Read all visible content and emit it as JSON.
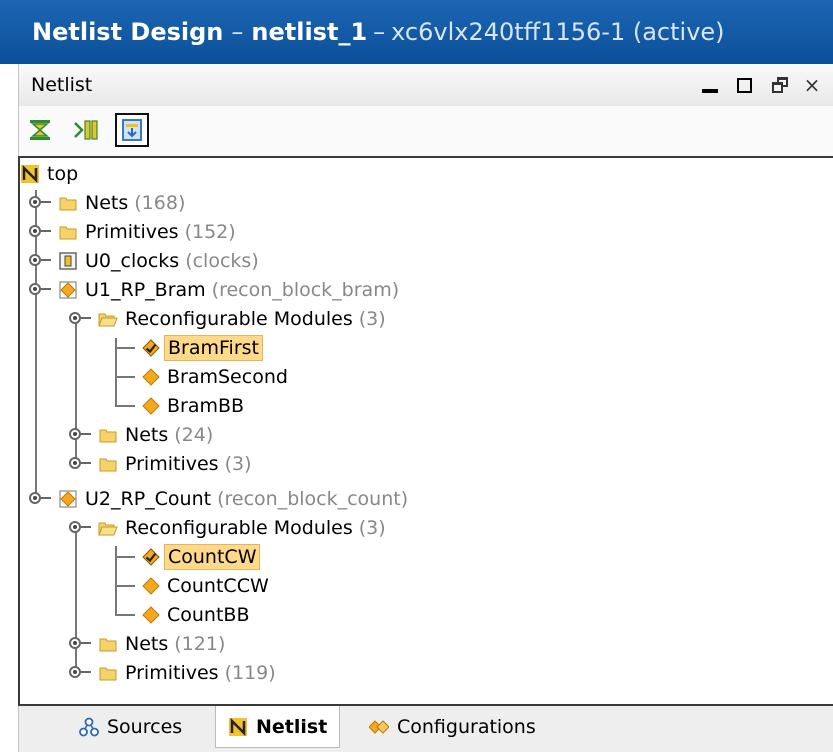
{
  "window": {
    "title_prefix": "Netlist Design",
    "title_sep1": "–",
    "title_bold": "netlist_1",
    "title_sep2": "–",
    "title_rest": "xc6vlx240tff1156-1 (active)"
  },
  "panel": {
    "title": "Netlist",
    "close_glyph": "×"
  },
  "toolbar": {
    "buttons": [
      {
        "icon": "collapse-all-icon"
      },
      {
        "icon": "expand-all-icon"
      },
      {
        "icon": "show-hierarchy-icon",
        "active": true
      }
    ]
  },
  "tree": {
    "root": "top",
    "nodes": [
      {
        "label": "Nets",
        "paren": "(168)",
        "icon": "folder-icon"
      },
      {
        "label": "Primitives",
        "paren": "(152)",
        "icon": "folder-icon"
      },
      {
        "label": "U0_clocks",
        "paren": "(clocks)",
        "icon": "black-box-cell-icon"
      },
      {
        "label": "U1_RP_Bram",
        "paren": "(recon_block_bram)",
        "icon": "reconfigurable-partition-icon"
      },
      {
        "label": "Reconfigurable Modules",
        "paren": "(3)",
        "icon": "open-folder-icon"
      },
      {
        "label": "BramFirst",
        "paren": "",
        "icon": "active-module-icon",
        "selected": true
      },
      {
        "label": "BramSecond",
        "paren": "",
        "icon": "module-icon"
      },
      {
        "label": "BramBB",
        "paren": "",
        "icon": "module-icon"
      },
      {
        "label": "Nets",
        "paren": "(24)",
        "icon": "folder-icon"
      },
      {
        "label": "Primitives",
        "paren": "(3)",
        "icon": "folder-icon"
      },
      {
        "label": "U2_RP_Count",
        "paren": "(recon_block_count)",
        "icon": "reconfigurable-partition-icon"
      },
      {
        "label": "Reconfigurable Modules",
        "paren": "(3)",
        "icon": "open-folder-icon"
      },
      {
        "label": "CountCW",
        "paren": "",
        "icon": "active-module-icon",
        "selected": true
      },
      {
        "label": "CountCCW",
        "paren": "",
        "icon": "module-icon"
      },
      {
        "label": "CountBB",
        "paren": "",
        "icon": "module-icon"
      },
      {
        "label": "Nets",
        "paren": "(121)",
        "icon": "folder-icon"
      },
      {
        "label": "Primitives",
        "paren": "(119)",
        "icon": "folder-icon"
      }
    ]
  },
  "tabs": [
    {
      "label": "Sources",
      "icon": "sources-icon"
    },
    {
      "label": "Netlist",
      "icon": "netlist-icon",
      "active": true
    },
    {
      "label": "Configurations",
      "icon": "configurations-icon"
    }
  ],
  "colors": {
    "title_bar": "#1560ad",
    "selection": "#ffd98a",
    "folder": "#f0c34f",
    "module_diamond": "#f4a81d"
  }
}
